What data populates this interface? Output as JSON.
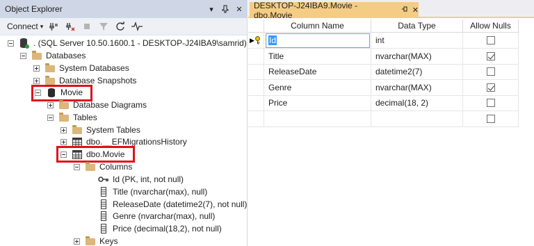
{
  "object_explorer": {
    "title": "Object Explorer",
    "title_buttons": [
      "▾",
      "📌",
      "✕"
    ],
    "toolbar": {
      "connect_label": "Connect",
      "icons": [
        "connect-object-icon",
        "disconnect-icon",
        "stop-icon",
        "filter-icon",
        "refresh-icon",
        "activity-monitor-icon"
      ]
    },
    "tree": [
      {
        "label": ". (SQL Server 10.50.1600.1 - DESKTOP-J24IBA9\\samrid)"
      },
      {
        "label": "Databases"
      },
      {
        "label": "System Databases"
      },
      {
        "label": "Database Snapshots"
      },
      {
        "label": "Movie"
      },
      {
        "label": "Database Diagrams"
      },
      {
        "label": "Tables"
      },
      {
        "label": "System Tables"
      },
      {
        "label": "dbo.__EFMigrationsHistory"
      },
      {
        "label": "dbo.Movie"
      },
      {
        "label": "Columns"
      },
      {
        "label": "Id (PK, int, not null)"
      },
      {
        "label": "Title (nvarchar(max), null)"
      },
      {
        "label": "ReleaseDate (datetime2(7), not null)"
      },
      {
        "label": "Genre (nvarchar(max), null)"
      },
      {
        "label": "Price (decimal(18,2), not null)"
      },
      {
        "label": "Keys"
      }
    ]
  },
  "designer": {
    "tab_title": "DESKTOP-J24IBA9.Movie - dbo.Movie",
    "headers": {
      "column_name": "Column Name",
      "data_type": "Data Type",
      "allow_nulls": "Allow Nulls"
    },
    "rows": [
      {
        "name": "Id",
        "type": "int",
        "allow_nulls": false,
        "primary_key": true
      },
      {
        "name": "Title",
        "type": "nvarchar(MAX)",
        "allow_nulls": true
      },
      {
        "name": "ReleaseDate",
        "type": "datetime2(7)",
        "allow_nulls": false
      },
      {
        "name": "Genre",
        "type": "nvarchar(MAX)",
        "allow_nulls": true
      },
      {
        "name": "Price",
        "type": "decimal(18, 2)",
        "allow_nulls": false
      },
      {
        "name": "",
        "type": "",
        "allow_nulls": false
      }
    ]
  },
  "colors": {
    "highlight_box": "#e0101b",
    "tab_accent": "#f5cc84",
    "panel_header": "#cfd6e5"
  }
}
